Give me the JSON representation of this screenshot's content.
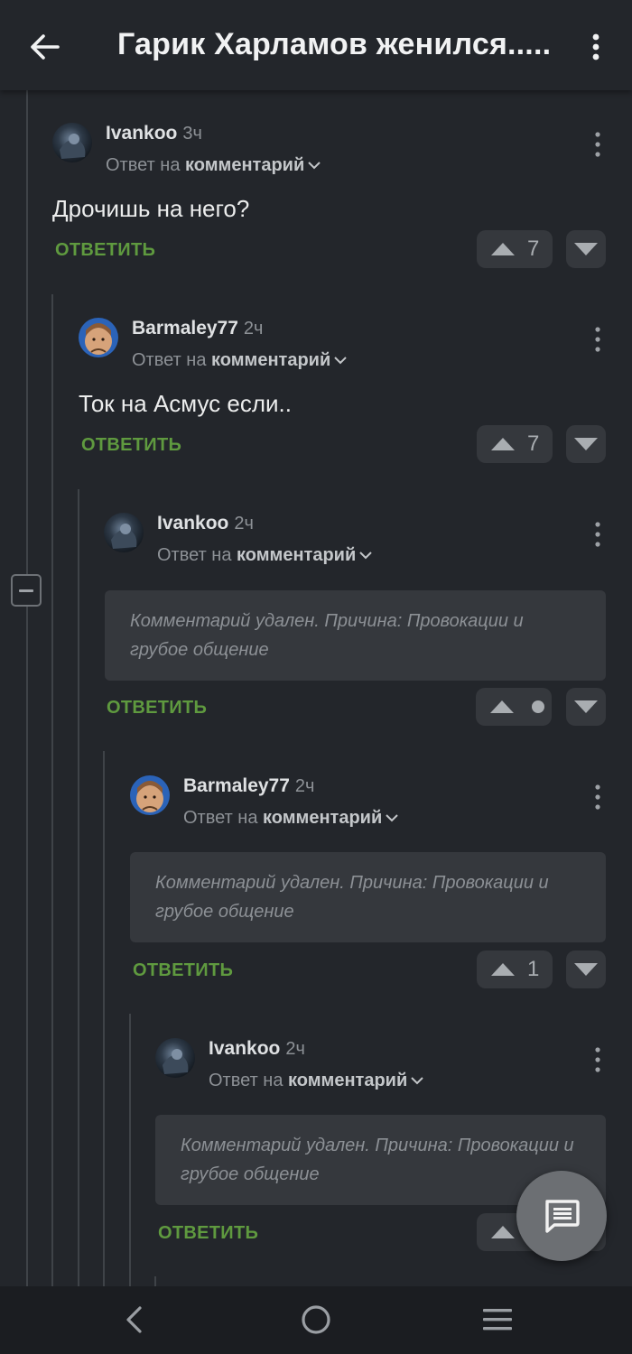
{
  "header": {
    "title": "Гарик Харламов женился......"
  },
  "comments": [
    {
      "author": "Ivankoo",
      "time": "3ч",
      "reply_prefix": "Ответ на",
      "reply_target": "комментарий",
      "text": "Дрочишь на него?",
      "reply_label": "ОТВЕТИТЬ",
      "score": "7"
    },
    {
      "author": "Barmaley77",
      "time": "2ч",
      "reply_prefix": "Ответ на",
      "reply_target": "комментарий",
      "text": "Ток на Асмус если..",
      "reply_label": "ОТВЕТИТЬ",
      "score": "7"
    },
    {
      "author": "Ivankoo",
      "time": "2ч",
      "reply_prefix": "Ответ на",
      "reply_target": "комментарий",
      "deleted_text": "Комментарий удален. Причина: Провокации и грубое общение",
      "reply_label": "ОТВЕТИТЬ",
      "score": ""
    },
    {
      "author": "Barmaley77",
      "time": "2ч",
      "reply_prefix": "Ответ на",
      "reply_target": "комментарий",
      "deleted_text": "Комментарий удален. Причина: Провокации и грубое общение",
      "reply_label": "ОТВЕТИТЬ",
      "score": "1"
    },
    {
      "author": "Ivankoo",
      "time": "2ч",
      "reply_prefix": "Ответ на",
      "reply_target": "комментарий",
      "deleted_text": "Комментарий удален. Причина: Провокации и грубое общение",
      "reply_label": "ОТВЕТИТЬ"
    }
  ],
  "colors": {
    "background": "#23262b",
    "reply_action": "#5f9a3f",
    "vote_button": "#35383d",
    "fab": "#6c6f73"
  },
  "icons": {
    "back": "arrow-left-icon",
    "more": "more-vertical-icon",
    "collapse": "minus-square-icon",
    "fab": "comment-icon"
  }
}
